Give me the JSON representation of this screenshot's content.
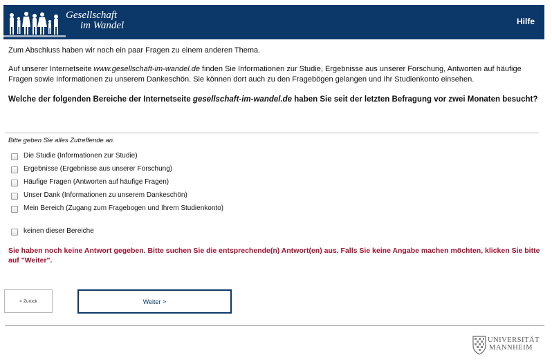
{
  "header": {
    "logo_line1": "Gesellschaft",
    "logo_line2": "im Wandel",
    "help_label": "Hilfe"
  },
  "intro": {
    "text1": "Zum Abschluss haben wir noch ein paar Fragen zu einem anderen Thema.",
    "text2_before": "Auf unserer Internetseite ",
    "text2_site": "www.gesellschaft-im-wandel.de",
    "text2_after": " finden Sie Informationen zur Studie, Ergebnisse aus unserer Forschung, Antworten auf häufige Fragen sowie Informationen zu unserem Dankeschön. Sie können dort auch zu den Fragebögen gelangen und Ihr Studienkonto einsehen."
  },
  "question": {
    "before": "Welche der folgenden Bereiche der Internetseite ",
    "site": "gesellschaft-im-wandel.de",
    "after": " haben Sie seit der letzten Befragung vor zwei Monaten besucht?",
    "instruction": "Bitte geben Sie alles Zutreffende an."
  },
  "options": [
    {
      "label": "Die Studie (Informationen zur Studie)",
      "checked": false
    },
    {
      "label": "Ergebnisse (Ergebnisse aus unserer Forschung)",
      "checked": false
    },
    {
      "label": "Häufige Fragen (Antworten auf häufige Fragen)",
      "checked": false
    },
    {
      "label": "Unser Dank (Informationen zu unserem Dankeschön)",
      "checked": false
    },
    {
      "label": "Mein Bereich (Zugang zum Fragebogen und Ihrem Studienkonto)",
      "checked": false
    },
    {
      "label": "keinen dieser Bereiche",
      "checked": false
    }
  ],
  "error_message": "Sie haben noch keine Antwort gegeben. Bitte suchen Sie die entsprechende(n) Antwort(en) aus. Falls Sie keine Angabe machen möchten, klicken Sie bitte auf \"Weiter\".",
  "nav": {
    "back_label": "< Zurück",
    "next_label": "Weiter >"
  },
  "footer": {
    "uni_line1": "UNIVERSITÄT",
    "uni_line2": "MANNHEIM"
  },
  "colors": {
    "header_bg": "#0c3769",
    "error": "#a0102f"
  }
}
